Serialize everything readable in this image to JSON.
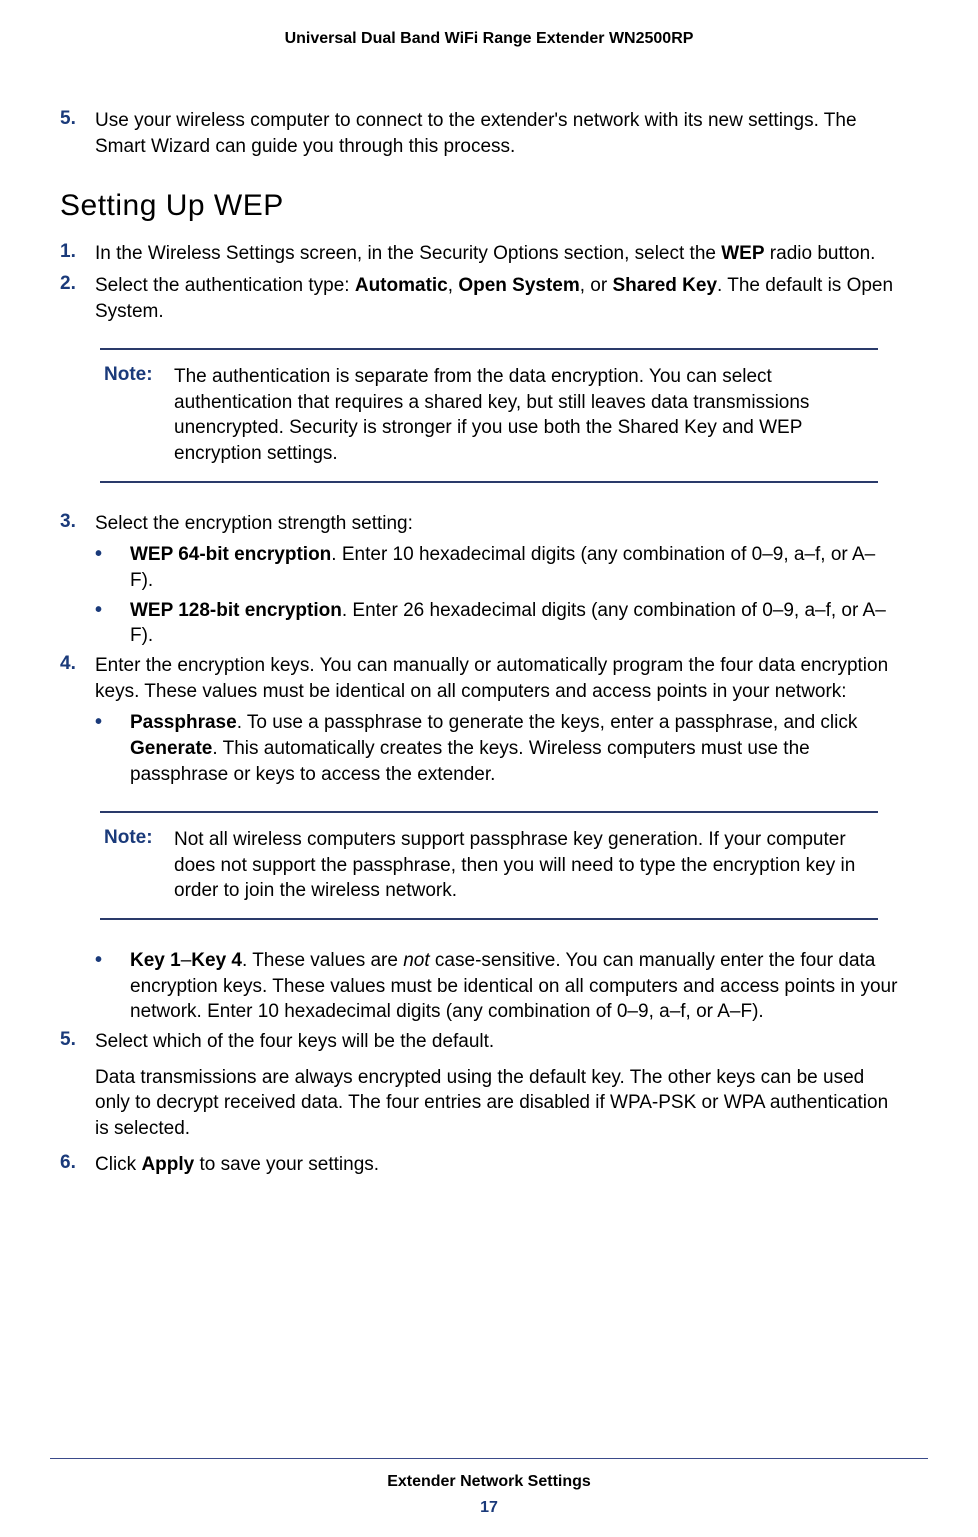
{
  "header": {
    "title": "Universal Dual Band WiFi Range Extender WN2500RP"
  },
  "steps_top": {
    "num5": "5.",
    "text5": "Use your wireless computer to connect to the extender's network with its new settings. The Smart Wizard can guide you through this process."
  },
  "heading": "Setting Up WEP",
  "wep_steps": {
    "num1": "1.",
    "text1_a": "In the Wireless Settings screen, in the Security Options section, select the ",
    "text1_b": "WEP",
    "text1_c": " radio button.",
    "num2": "2.",
    "text2_a": "Select the authentication type: ",
    "text2_b": "Automatic",
    "text2_c": ", ",
    "text2_d": "Open System",
    "text2_e": ", or ",
    "text2_f": "Shared Key",
    "text2_g": ". The default is Open System.",
    "num3": "3.",
    "text3": "Select the encryption strength setting:",
    "num4": "4.",
    "text4": "Enter the encryption keys. You can manually or automatically program the four data encryption keys. These values must be identical on all computers and access points in your network:",
    "num5": "5.",
    "text5": "Select which of the four keys will be the default.",
    "text5_after": "Data transmissions are always encrypted using the default key. The other keys can be used only to decrypt received data. The four entries are disabled if WPA-PSK or WPA authentication is selected.",
    "num6": "6.",
    "text6_a": "Click ",
    "text6_b": "Apply",
    "text6_c": " to save your settings."
  },
  "note1": {
    "label": "Note:",
    "text": "The authentication is separate from the data encryption. You can select authentication that requires a shared key, but still leaves data transmissions unencrypted. Security is stronger if you use both the Shared Key and WEP encryption settings."
  },
  "note2": {
    "label": "Note:",
    "text": "Not all wireless computers support passphrase key generation. If your computer does not support the passphrase, then you will need to type the encryption key in order to join the wireless network."
  },
  "bullets3": {
    "b1_a": "WEP 64-bit encryption",
    "b1_b": ". Enter 10 hexadecimal digits (any combination of 0–9, a–f, or A–F).",
    "b2_a": "WEP 128-bit encryption",
    "b2_b": ". Enter 26 hexadecimal digits (any combination of 0–9, a–f, or A–F)."
  },
  "bullets4": {
    "b1_a": "Passphrase",
    "b1_b": ". To use a passphrase to generate the keys, enter a passphrase, and click ",
    "b1_c": "Generate",
    "b1_d": ". This automatically creates the keys. Wireless computers must use the passphrase or keys to access the extender.",
    "b2_a": "Key 1",
    "b2_b": "–",
    "b2_c": "Key 4",
    "b2_d": ". These values are ",
    "b2_e": "not",
    "b2_f": " case-sensitive. You can manually enter the four data encryption keys. These values must be identical on all computers and access points in your network. Enter 10 hexadecimal digits (any combination of 0–9, a–f, or A–F)."
  },
  "footer": {
    "section": "Extender Network Settings",
    "page": "17"
  }
}
